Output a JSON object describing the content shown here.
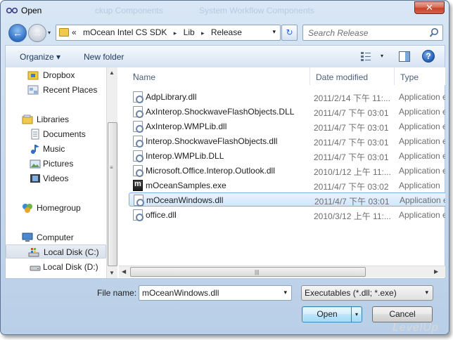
{
  "window": {
    "title": "Open",
    "close_label": "✕",
    "background_titles": [
      "ckup Components",
      "System Workflow Components"
    ]
  },
  "address_bar": {
    "overflow": "«",
    "crumbs": [
      "mOcean Intel CS SDK",
      "Lib",
      "Release"
    ],
    "separator": "▸",
    "dropdown": "▾",
    "refresh": "↻"
  },
  "search": {
    "placeholder": "Search Release"
  },
  "command_bar": {
    "organize_label": "Organize ▾",
    "new_folder_label": "New folder",
    "view_dropdown": "▾",
    "help_label": "?"
  },
  "nav_pane": {
    "items": [
      {
        "label": "Dropbox",
        "icon": "dropbox-folder-icon"
      },
      {
        "label": "Recent Places",
        "icon": "recent-places-icon"
      },
      {
        "label": "Libraries",
        "icon": "libraries-icon"
      },
      {
        "label": "Documents",
        "icon": "documents-icon"
      },
      {
        "label": "Music",
        "icon": "music-icon"
      },
      {
        "label": "Pictures",
        "icon": "pictures-icon"
      },
      {
        "label": "Videos",
        "icon": "videos-icon"
      },
      {
        "label": "Homegroup",
        "icon": "homegroup-icon"
      },
      {
        "label": "Computer",
        "icon": "computer-icon"
      },
      {
        "label": "Local Disk (C:)",
        "icon": "system-drive-icon",
        "selected": true
      },
      {
        "label": "Local Disk (D:)",
        "icon": "drive-icon"
      }
    ]
  },
  "file_list": {
    "columns": [
      "Name",
      "Date modified",
      "Type"
    ],
    "sort_indicator": "^",
    "rows": [
      {
        "name": "AdpLibrary.dll",
        "date": "2011/2/14 下午 11:...",
        "type": "Application e",
        "icon": "dll-file-icon"
      },
      {
        "name": "AxInterop.ShockwaveFlashObjects.DLL",
        "date": "2011/4/7 下午 03:01",
        "type": "Application e",
        "icon": "dll-file-icon"
      },
      {
        "name": "AxInterop.WMPLib.dll",
        "date": "2011/4/7 下午 03:01",
        "type": "Application e",
        "icon": "dll-file-icon"
      },
      {
        "name": "Interop.ShockwaveFlashObjects.dll",
        "date": "2011/4/7 下午 03:01",
        "type": "Application e",
        "icon": "dll-file-icon"
      },
      {
        "name": "Interop.WMPLib.DLL",
        "date": "2011/4/7 下午 03:01",
        "type": "Application e",
        "icon": "dll-file-icon"
      },
      {
        "name": "Microsoft.Office.Interop.Outlook.dll",
        "date": "2010/1/12 上午 11:...",
        "type": "Application e",
        "icon": "dll-file-icon"
      },
      {
        "name": "mOceanSamples.exe",
        "date": "2011/4/7 下午 03:02",
        "type": "Application",
        "icon": "exe-file-icon"
      },
      {
        "name": "mOceanWindows.dll",
        "date": "2011/4/7 下午 03:01",
        "type": "Application e",
        "icon": "dll-file-icon",
        "selected": true
      },
      {
        "name": "office.dll",
        "date": "2010/3/12 上午 11:...",
        "type": "Application e",
        "icon": "dll-file-icon"
      }
    ]
  },
  "bottom": {
    "file_name_label": "File name:",
    "file_name_value": "mOceanWindows.dll",
    "filter_value": "Executables (*.dll; *.exe)",
    "open_label": "Open",
    "cancel_label": "Cancel",
    "dropdown": "▾",
    "watermark": "LevelUp"
  },
  "colors": {
    "frame": "#c4d7ec",
    "selection": "#d2e6fb",
    "close_button": "#c7422a"
  }
}
